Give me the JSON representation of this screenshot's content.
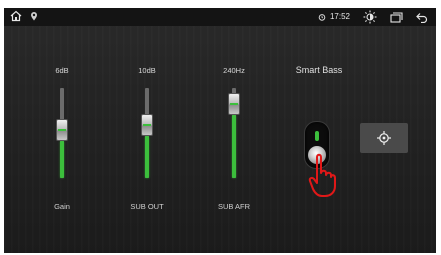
{
  "status_bar": {
    "left_icons": [
      "home-icon",
      "location-pin-icon"
    ],
    "right": {
      "alarm_icon": "alarm-icon",
      "time": "17:52",
      "brightness_icon": "brightness-icon",
      "window_icon": "windows-icon",
      "back_icon": "back-icon"
    }
  },
  "equalizer": {
    "sliders": [
      {
        "top_label": "6dB",
        "bottom_label": "Gain",
        "level": 0.55
      },
      {
        "top_label": "10dB",
        "bottom_label": "SUB OUT",
        "level": 0.62
      },
      {
        "top_label": "240Hz",
        "bottom_label": "SUB AFR",
        "level": 0.93
      }
    ]
  },
  "smart_bass": {
    "title": "Smart Bass",
    "toggle_state": "on",
    "target_button_icon": "crosshair-icon"
  },
  "colors": {
    "accent_green": "#3cbf3c",
    "background": "#232323",
    "hand_annotation": "#e01818"
  }
}
